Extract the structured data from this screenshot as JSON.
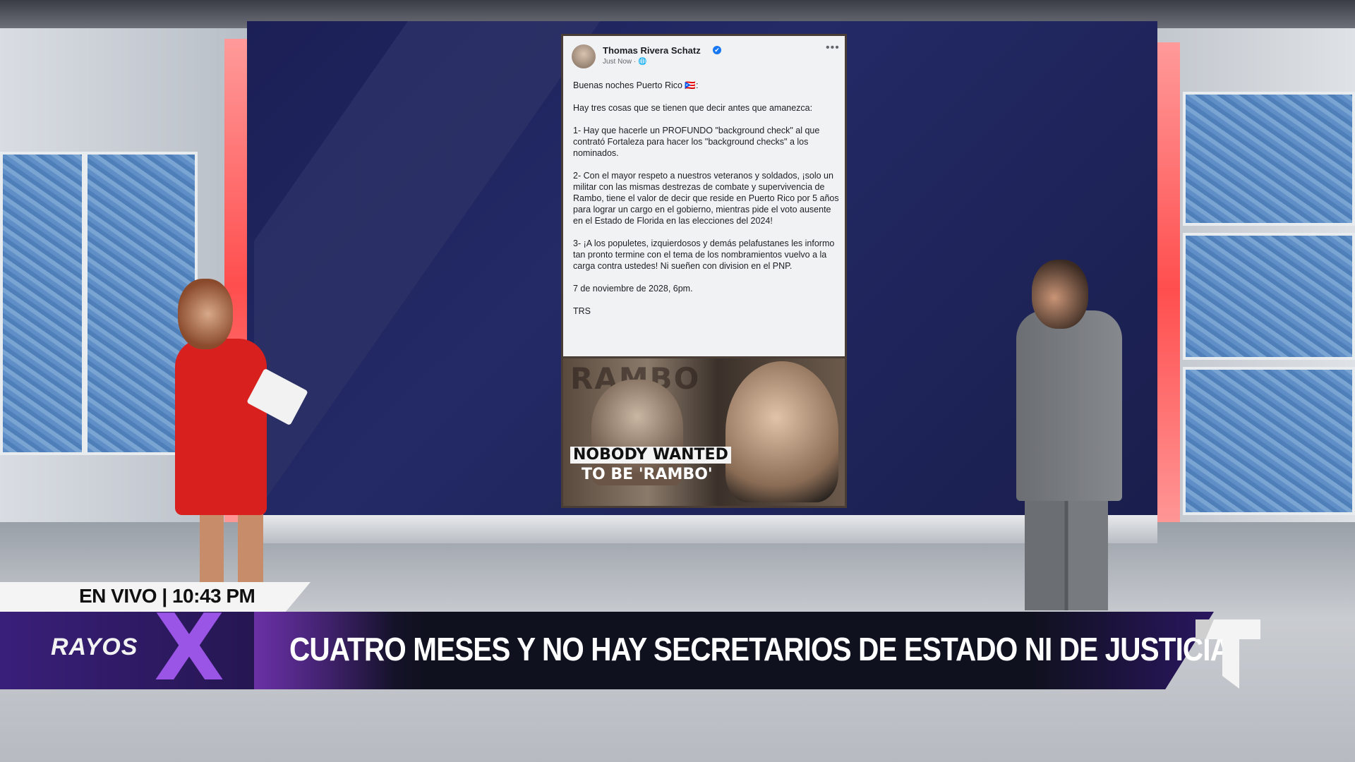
{
  "post": {
    "author": "Thomas Rivera Schatz",
    "verified_icon": "✔",
    "time": "Just Now · 🌐",
    "more": "•••",
    "paragraphs": [
      "Buenas noches Puerto Rico 🇵🇷:",
      "Hay tres cosas que se tienen que decir antes que amanezca:",
      "1- Hay que hacerle un PROFUNDO \"background check\" al que contrató Fortaleza para hacer los \"background checks\" a los nominados.",
      "2- Con el mayor respeto a nuestros veteranos y soldados, ¡solo un militar con las mismas destrezas de combate y supervivencia de Rambo, tiene el valor de decir que reside en Puerto Rico por 5 años para lograr un cargo en el gobierno, mientras pide el voto ausente en el Estado de Florida en las elecciones del 2024!",
      "3- ¡A los populetes, izquierdosos y demás pelafustanes les informo tan pronto termine con el tema de los nombramientos vuelvo a la carga contra ustedes! Ni sueñen con division en el PNP.",
      "7 de noviembre de 2028, 6pm.",
      "TRS"
    ],
    "image": {
      "background_word": "RAMBO",
      "caption_line1": "NOBODY WANTED",
      "caption_line2": "TO BE 'RAMBO'"
    }
  },
  "lower_third": {
    "live_label": "EN VIVO | 10:43 PM",
    "show_name": "RAYOS",
    "show_mark": "X",
    "headline": "CUATRO MESES Y NO HAY SECRETARIOS DE ESTADO NI DE JUSTICIA",
    "network_logo_icon": "telemundo-t-icon"
  },
  "colors": {
    "accent_purple": "#9a55e6",
    "bar_dark": "#10111f",
    "dress_red": "#d8201f",
    "videowall_navy": "#1b1f55"
  }
}
